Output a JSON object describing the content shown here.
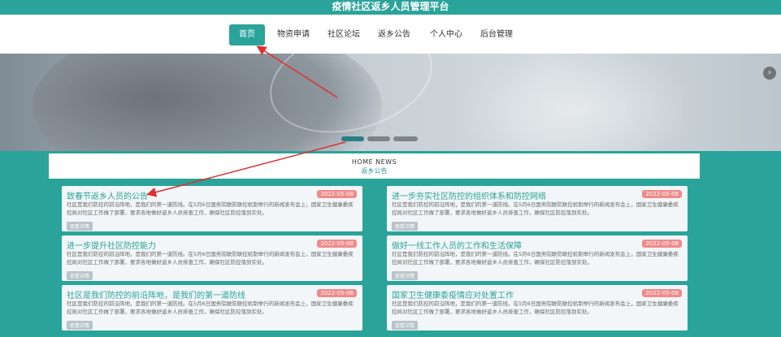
{
  "app": {
    "title": "疫情社区返乡人员管理平台"
  },
  "nav": {
    "items": [
      {
        "label": "首页",
        "active": true
      },
      {
        "label": "物资申请"
      },
      {
        "label": "社区论坛"
      },
      {
        "label": "返乡公告"
      },
      {
        "label": "个人中心"
      },
      {
        "label": "后台管理"
      }
    ]
  },
  "banner": {
    "next_icon": "›"
  },
  "news": {
    "heading_en": "HOME NEWS",
    "heading_cn": "返乡公告",
    "more_label": "查看详情",
    "items": [
      {
        "title": "致春节返乡人员的公告",
        "date": "2022-05-08",
        "excerpt": "社区是我们防控的前沿阵地，是我们的第一道防线。在5月6日国务院联防联控机制举行的新闻发布会上，国家卫生健康委疾控局对社区工作做了部署，要求各地做好返乡人员排查工作，确保社区防控落到实处。"
      },
      {
        "title": "进一步夯实社区防控的组织体系和防控网络",
        "date": "2022-05-08",
        "excerpt": "社区是我们防控的前沿阵地，是我们的第一道防线。在5月6日国务院联防联控机制举行的新闻发布会上，国家卫生健康委疾控局对社区工作做了部署，要求各地做好返乡人员排查工作，确保社区防控落到实处。"
      },
      {
        "title": "进一步提升社区防控能力",
        "date": "2022-05-08",
        "excerpt": "社区是我们防控的前沿阵地，是我们的第一道防线。在5月6日国务院联防联控机制举行的新闻发布会上，国家卫生健康委疾控局对社区工作做了部署，要求各地做好返乡人员排查工作，确保社区防控落到实处。"
      },
      {
        "title": "做好一线工作人员的工作和生活保障",
        "date": "2022-05-08",
        "excerpt": "社区是我们防控的前沿阵地，是我们的第一道防线。在5月6日国务院联防联控机制举行的新闻发布会上，国家卫生健康委疾控局对社区工作做了部署，要求各地做好返乡人员排查工作，确保社区防控落到实处。"
      },
      {
        "title": "社区是我们防控的前沿阵地，是我们的第一道防线",
        "date": "2022-05-08",
        "excerpt": "社区是我们防控的前沿阵地，是我们的第一道防线。在5月6日国务院联防联控机制举行的新闻发布会上，国家卫生健康委疾控局对社区工作做了部署，要求各地做好返乡人员排查工作，确保社区防控落到实处。"
      },
      {
        "title": "国家卫生健康委疫情应对处置工作",
        "date": "2022-05-08",
        "excerpt": "社区是我们防控的前沿阵地，是我们的第一道防线。在5月6日国务院联防联控机制举行的新闻发布会上，国家卫生健康委疾控局对社区工作做了部署，要求各地做好返乡人员排查工作，确保社区防控落到实处。"
      }
    ]
  },
  "colors": {
    "brand": "#2aa39a",
    "date_badge": "#f18a8a",
    "annotation_arrow": "#e03030"
  }
}
